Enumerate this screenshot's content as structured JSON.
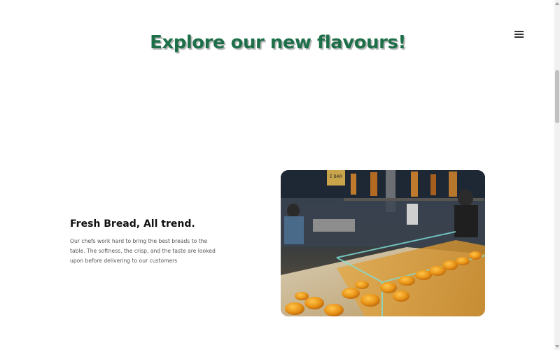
{
  "header": {
    "title": "Explore our new flavours!",
    "menu_icon": "hamburger-menu-icon"
  },
  "feature": {
    "heading": "Fresh Bread, All trend.",
    "description": "Our chefs work hard to bring the best breads to the table. The softness, the crisp, and the taste are looked upon before delivering to our customers",
    "image_sign_text": "E BAR"
  },
  "colors": {
    "title": "#1d6f49",
    "title_shadow": "#b9b9b9",
    "heading": "#111111",
    "body_text": "#555555"
  }
}
